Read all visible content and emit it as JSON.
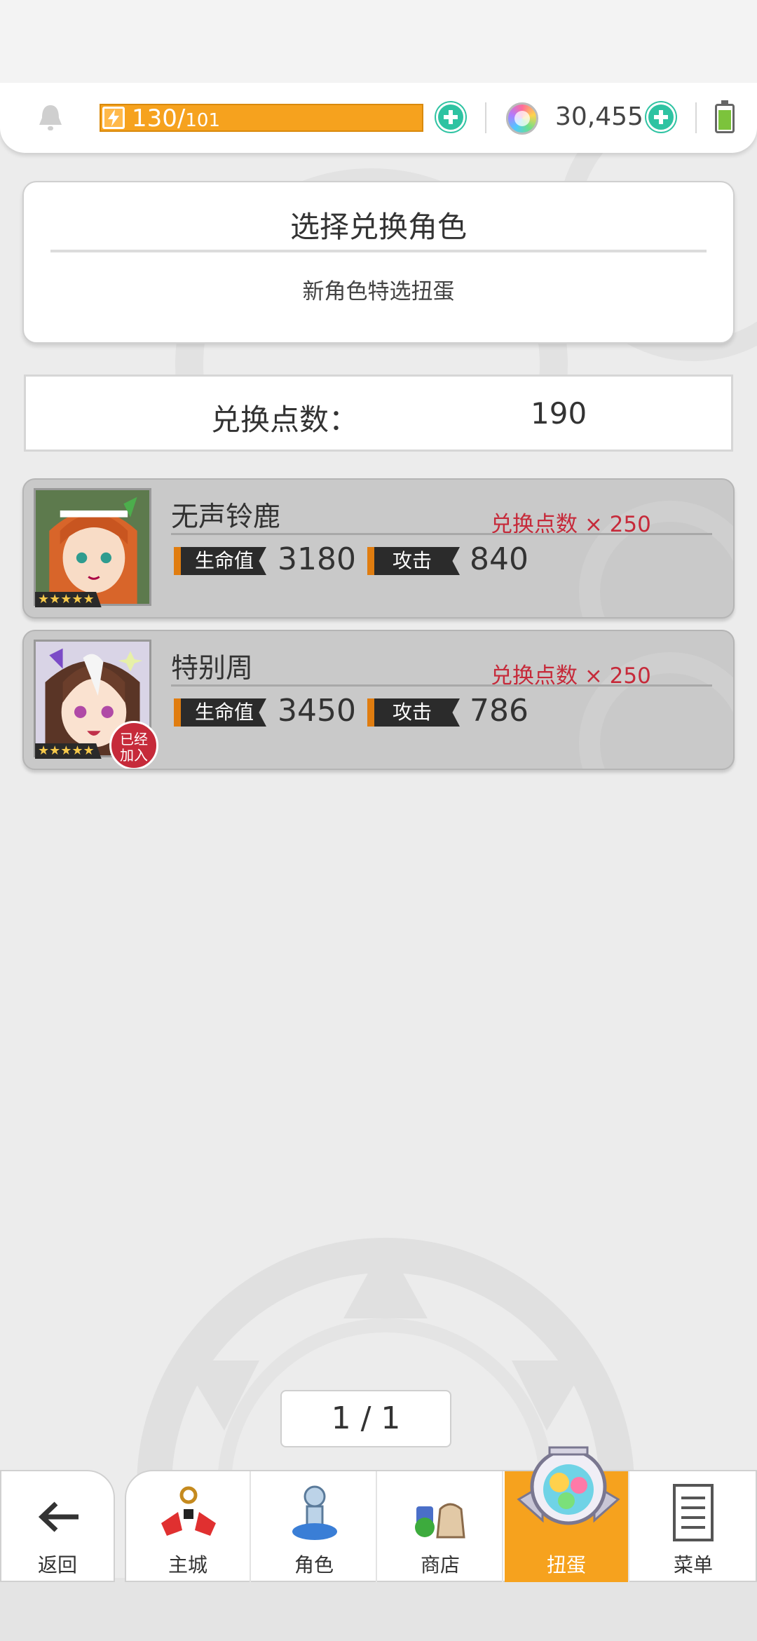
{
  "resources": {
    "stamina_current": "130",
    "stamina_separator": "/",
    "stamina_max": "101",
    "gems": "30,455"
  },
  "header": {
    "title": "选择兑换角色",
    "subtitle": "新角色特选扭蛋"
  },
  "points": {
    "label": "兑换点数：",
    "value": "190"
  },
  "characters": [
    {
      "name": "无声铃鹿",
      "cost": "兑换点数 × 250",
      "hp_label": "生命值",
      "hp": "3180",
      "atk_label": "攻击",
      "atk": "840",
      "stars": "★★★★★",
      "joined": false
    },
    {
      "name": "特别周",
      "cost": "兑换点数 × 250",
      "hp_label": "生命值",
      "hp": "3450",
      "atk_label": "攻击",
      "atk": "786",
      "stars": "★★★★★",
      "joined": true,
      "joined_label_1": "已经",
      "joined_label_2": "加入"
    }
  ],
  "pager": {
    "text": "1 / 1"
  },
  "nav": {
    "back": "返回",
    "items": [
      {
        "label": "主城",
        "icon": "castle-icon"
      },
      {
        "label": "角色",
        "icon": "character-icon"
      },
      {
        "label": "商店",
        "icon": "shop-icon"
      },
      {
        "label": "扭蛋",
        "icon": "gacha-icon",
        "active": true
      },
      {
        "label": "菜单",
        "icon": "menu-icon"
      }
    ]
  },
  "colors": {
    "accent": "#f6a21e",
    "plus": "#2ec3a2",
    "cost": "#c62a3a"
  }
}
